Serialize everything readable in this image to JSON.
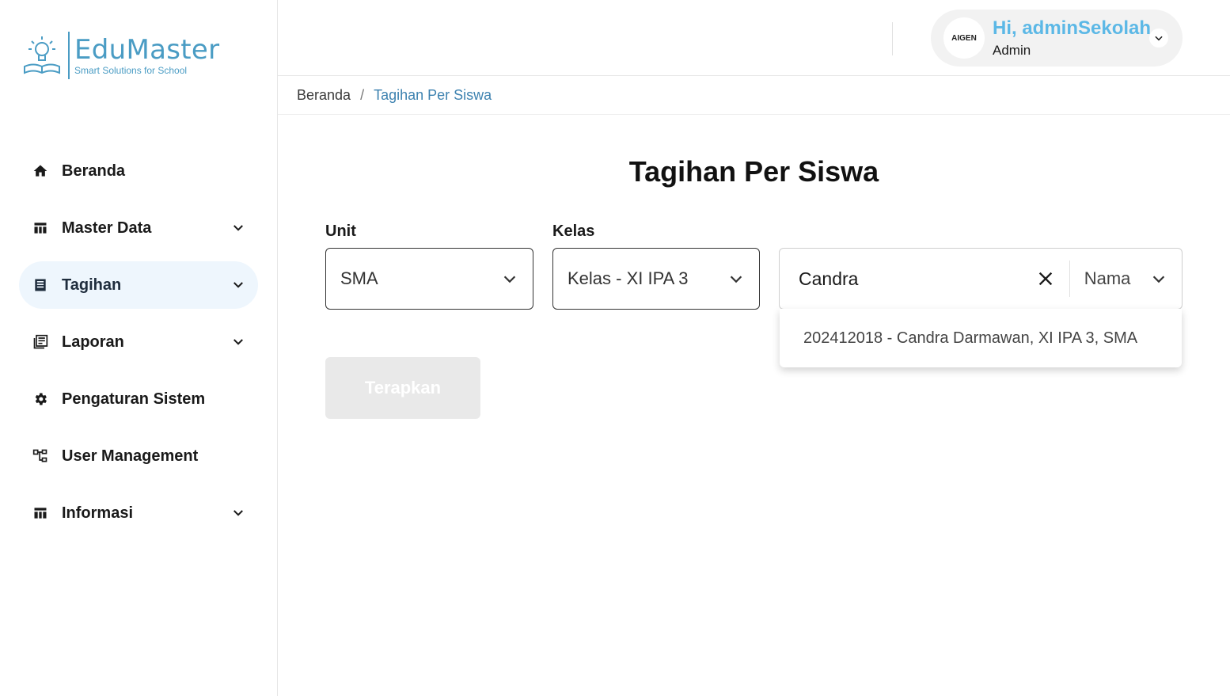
{
  "brand": {
    "name": "EduMaster",
    "tagline": "Smart Solutions for School",
    "color": "#4a9cc4"
  },
  "sidebar": {
    "items": [
      {
        "label": "Beranda",
        "icon": "home-icon",
        "expandable": false,
        "active": false
      },
      {
        "label": "Master Data",
        "icon": "table-icon",
        "expandable": true,
        "active": false
      },
      {
        "label": "Tagihan",
        "icon": "list-icon",
        "expandable": true,
        "active": true
      },
      {
        "label": "Laporan",
        "icon": "library-icon",
        "expandable": true,
        "active": false
      },
      {
        "label": "Pengaturan Sistem",
        "icon": "gear-icon",
        "expandable": false,
        "active": false
      },
      {
        "label": "User Management",
        "icon": "hierarchy-icon",
        "expandable": false,
        "active": false
      },
      {
        "label": "Informasi",
        "icon": "table-icon",
        "expandable": true,
        "active": false
      }
    ]
  },
  "header": {
    "avatar_text": "AIGEN",
    "greeting": "Hi, adminSekolah",
    "role": "Admin"
  },
  "breadcrumb": {
    "home": "Beranda",
    "separator": "/",
    "current": "Tagihan Per Siswa"
  },
  "main": {
    "title": "Tagihan Per Siswa",
    "unit": {
      "label": "Unit",
      "value": "SMA"
    },
    "kelas": {
      "label": "Kelas",
      "value": "Kelas - XI IPA 3"
    },
    "search": {
      "value": "Candra",
      "type": "Nama"
    },
    "suggestion": "202412018 - Candra Darmawan, XI IPA 3, SMA",
    "apply_label": "Terapkan"
  },
  "colors": {
    "accent": "#5cb8e6",
    "active_bg": "#eef6fd",
    "breadcrumb_current": "#3d82b0"
  }
}
